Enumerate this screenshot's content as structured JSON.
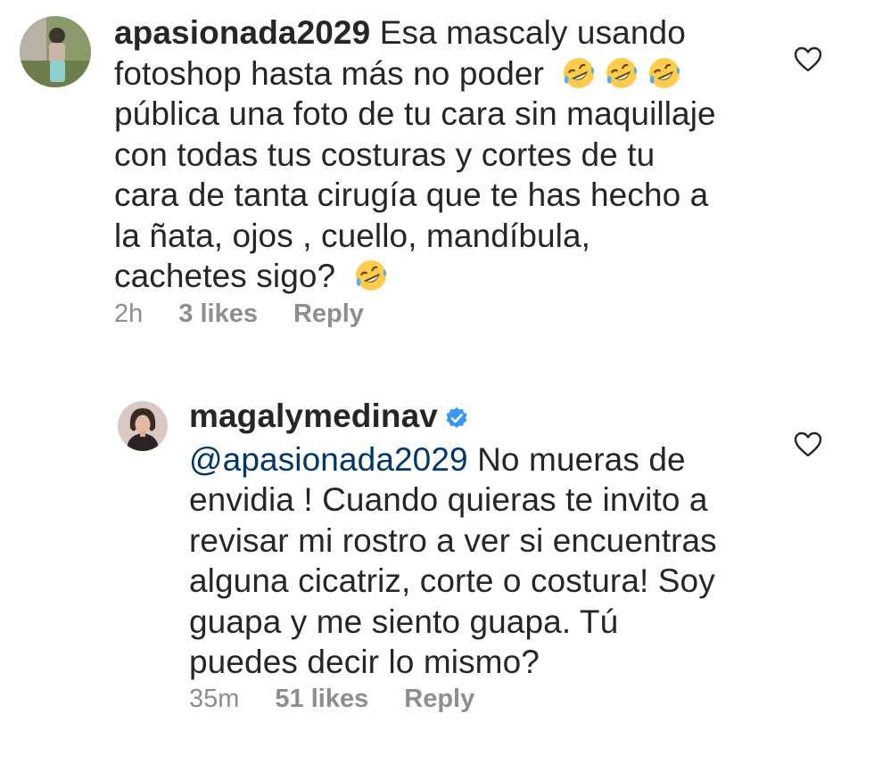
{
  "comments": [
    {
      "username": "apasionada2029",
      "lines": [
        "Esa mascaly usando",
        "fotoshop hasta más no poder",
        "pública una foto de tu cara sin maquillaje",
        "con todas tus costuras y cortes de tu",
        "cara de tanta cirugía que te has hecho a",
        "la ñata, ojos , cuello, mandíbula,",
        "cachetes sigo?"
      ],
      "emojis_line2": [
        "rolling-on-floor-laughing",
        "rolling-on-floor-laughing",
        "rolling-on-floor-laughing"
      ],
      "emojis_line7": [
        "rolling-on-floor-laughing"
      ],
      "time": "2h",
      "likes": "3 likes",
      "reply": "Reply"
    },
    {
      "username": "magalymedinav",
      "verified": true,
      "mention": "@apasionada2029",
      "lines": [
        "No mueras de",
        "envidia ! Cuando quieras te invito a",
        "revisar mi rostro a ver si encuentras",
        "alguna cicatriz, corte o costura! Soy",
        "guapa y me siento guapa. Tú",
        "puedes decir lo mismo?"
      ],
      "time": "35m",
      "likes": "51 likes",
      "reply": "Reply"
    }
  ],
  "colors": {
    "text": "#262626",
    "secondary": "#8e8e8e",
    "mention": "#00376b",
    "verified": "#3897f0",
    "emoji_face": "#ffcc4d"
  }
}
